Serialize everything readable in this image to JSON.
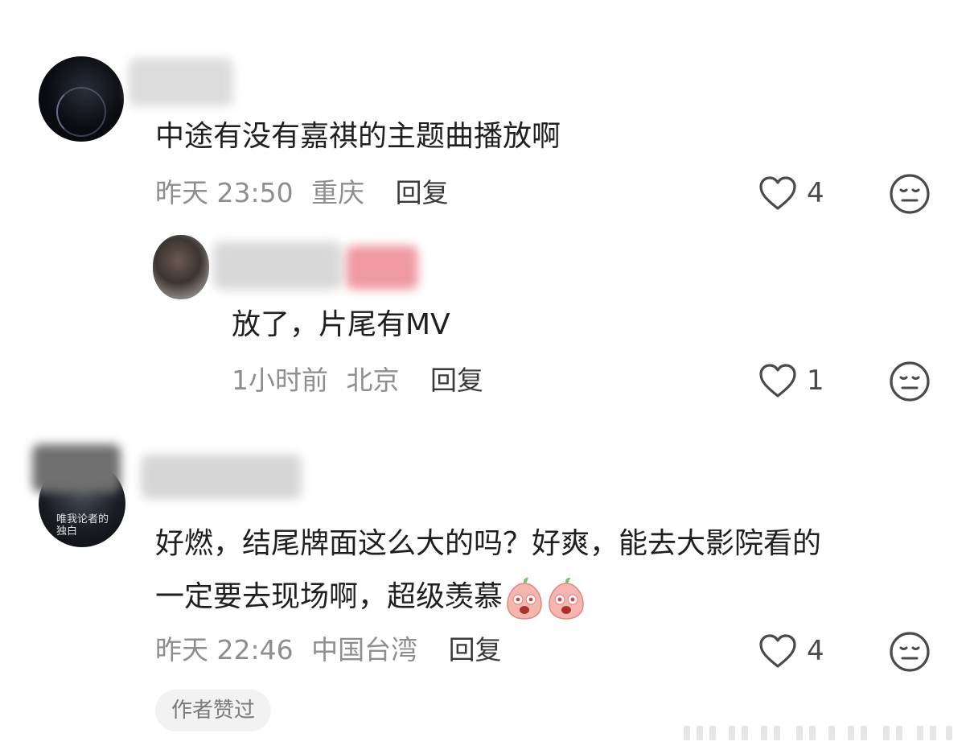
{
  "comments": [
    {
      "text": "中途有没有嘉祺的主题曲播放啊",
      "time": "昨天 23:50",
      "location": "重庆",
      "reply_label": "回复",
      "likes": "4",
      "replies": [
        {
          "text": "放了，片尾有MV",
          "time": "1小时前",
          "location": "北京",
          "reply_label": "回复",
          "likes": "1"
        }
      ]
    },
    {
      "text_line1": "好燃，结尾牌面这么大的吗？好爽，能去大影院看的",
      "text_line2": "一定要去现场啊，超级羡慕",
      "time": "昨天 22:46",
      "location": "中国台湾",
      "reply_label": "回复",
      "likes": "4",
      "badge": "作者赞过",
      "avatar_text": "唯我论者的独白"
    }
  ],
  "icons": {
    "like": "heart-outline-icon",
    "dislike": "expressionless-face-icon",
    "emoji": "peach-drool-emoji"
  },
  "colors": {
    "text": "#1f1f1f",
    "meta": "#8e8e8e",
    "reply": "#3a3a3a",
    "icon": "#4a4a4a",
    "badge_bg": "#f2f2f2"
  }
}
